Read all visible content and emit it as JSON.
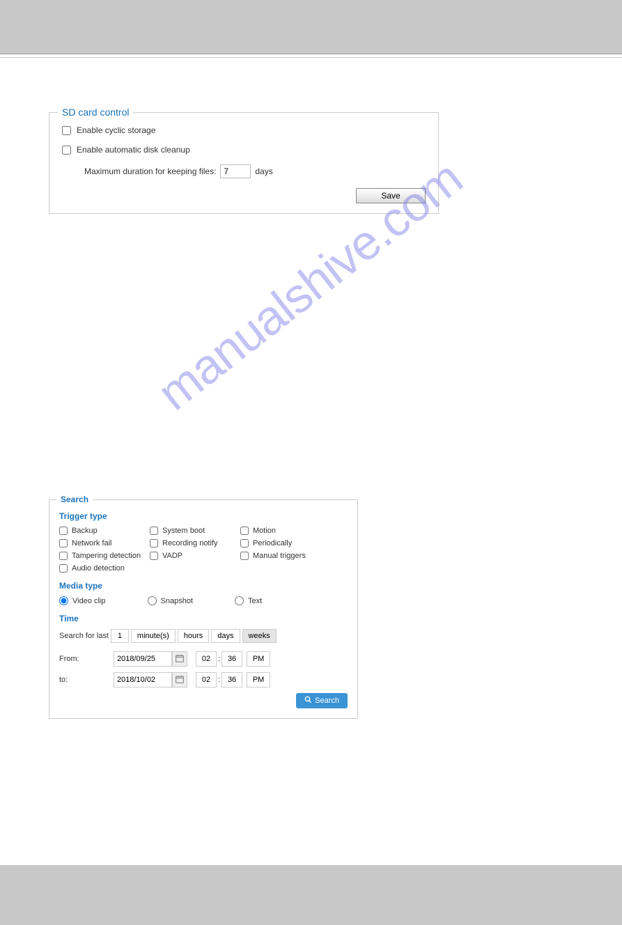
{
  "sd": {
    "legend": "SD card control",
    "cyclic_label": "Enable cyclic storage",
    "cleanup_label": "Enable automatic disk cleanup",
    "max_label": "Maximum duration for keeping files:",
    "max_value": "7",
    "max_unit": "days",
    "save_label": "Save"
  },
  "search": {
    "legend": "Search",
    "trigger_title": "Trigger type",
    "triggers": {
      "backup": "Backup",
      "system_boot": "System boot",
      "motion": "Motion",
      "network_fail": "Network fail",
      "recording_notify": "Recording notify",
      "periodically": "Periodically",
      "tampering": "Tampering detection",
      "vadp": "VADP",
      "manual": "Manual triggers",
      "audio": "Audio detection"
    },
    "media_title": "Media type",
    "media": {
      "video": "Video clip",
      "snapshot": "Snapshot",
      "text": "Text"
    },
    "time_title": "Time",
    "search_for_last_label": "Search for last",
    "search_for_last_value": "1",
    "units": {
      "minutes": "minute(s)",
      "hours": "hours",
      "days": "days",
      "weeks": "weeks"
    },
    "from_label": "From:",
    "to_label": "to:",
    "from_date": "2018/09/25",
    "from_hh": "02",
    "from_mm": "36",
    "from_ampm": "PM",
    "to_date": "2018/10/02",
    "to_hh": "02",
    "to_mm": "36",
    "to_ampm": "PM",
    "search_btn": "Search"
  },
  "watermark": "manualshive.com"
}
